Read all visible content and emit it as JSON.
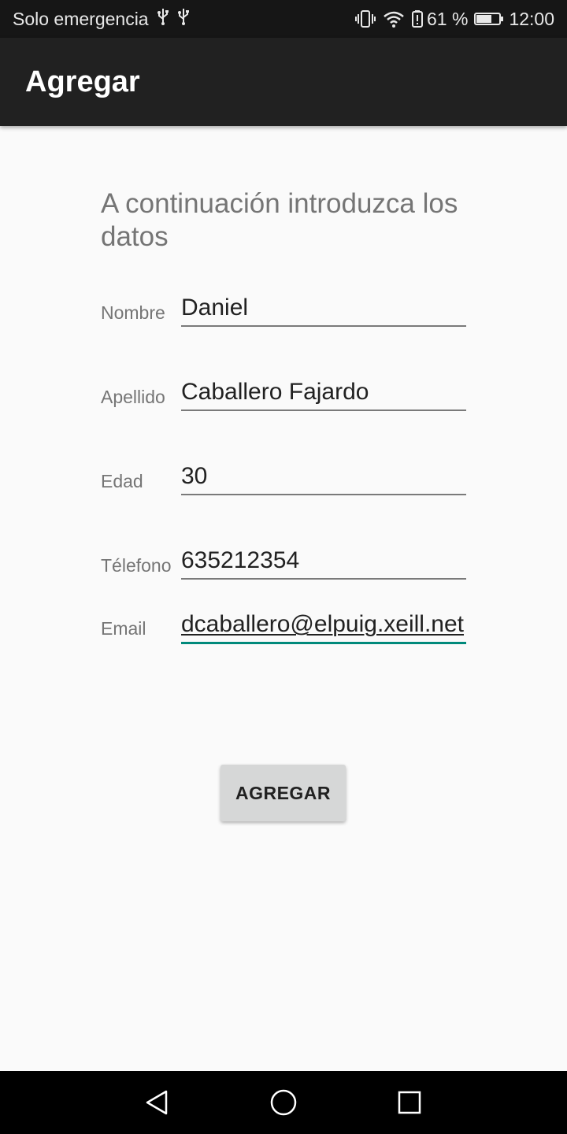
{
  "status_bar": {
    "carrier_text": "Solo emergencia",
    "usb_icons": [
      "usb-icon",
      "usb-icon"
    ],
    "icons": [
      "vibrate-icon",
      "wifi-icon",
      "battery-alert-icon"
    ],
    "battery_percent": "61 %",
    "battery_level": 0.61,
    "time": "12:00"
  },
  "app_bar": {
    "title": "Agregar"
  },
  "form": {
    "intro": "A continuación introduzca los datos",
    "fields": [
      {
        "label": "Nombre",
        "value": "Daniel"
      },
      {
        "label": "Apellido",
        "value": "Caballero Fajardo"
      },
      {
        "label": "Edad",
        "value": "30"
      },
      {
        "label": "Télefono",
        "value": "635212354"
      },
      {
        "label": "Email",
        "value": "dcaballero@elpuig.xeill.net"
      }
    ],
    "submit_label": "AGREGAR"
  },
  "nav_bar": {
    "icons": [
      "back-icon",
      "home-icon",
      "recents-icon"
    ]
  },
  "colors": {
    "status_bar": "#161616",
    "app_bar": "#212121",
    "background": "#fafafa",
    "accent": "#00897b",
    "button": "#d6d7d7"
  }
}
